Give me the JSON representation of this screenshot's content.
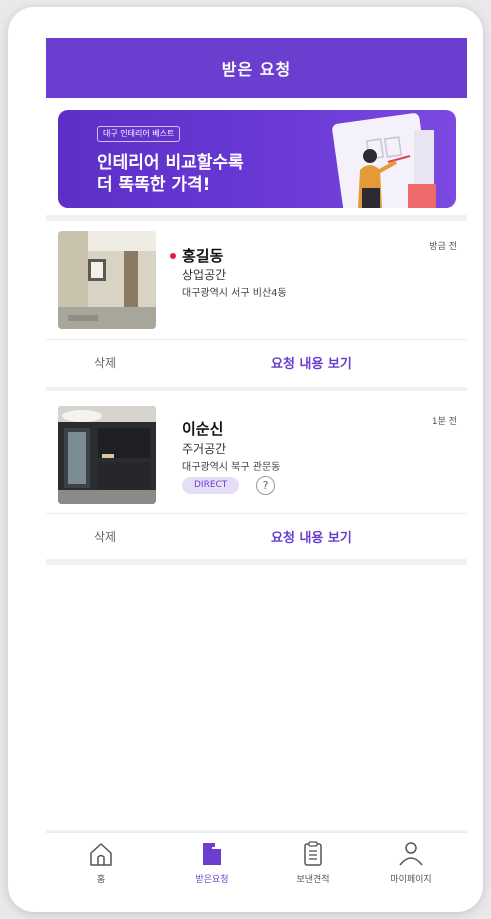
{
  "header": {
    "title": "받은 요청"
  },
  "banner": {
    "tag": "대구 인테리어 베스트",
    "line1": "인테리어 비교할수록",
    "line2": "더 똑똑한 가격!"
  },
  "requests": [
    {
      "name": "홍길동",
      "category": "상업공간",
      "address": "대구광역시 서구 비산4동",
      "time": "방금 전",
      "unread": true,
      "delete_label": "삭제",
      "view_label": "요청 내용 보기"
    },
    {
      "name": "이순신",
      "category": "주거공간",
      "address": "대구광역시 북구 관문동",
      "time": "1분 전",
      "badge": "DIRECT",
      "help": "?",
      "delete_label": "삭제",
      "view_label": "요청 내용 보기"
    }
  ],
  "nav": {
    "items": [
      {
        "label": "홈",
        "icon": "home-icon"
      },
      {
        "label": "받은요청",
        "icon": "folder-icon",
        "active": true
      },
      {
        "label": "보낸견적",
        "icon": "clipboard-icon"
      },
      {
        "label": "마이페이지",
        "icon": "user-icon"
      }
    ]
  },
  "colors": {
    "primary": "#6a3fd0",
    "unread_dot": "#e02040",
    "badge_bg": "#e6def7"
  }
}
